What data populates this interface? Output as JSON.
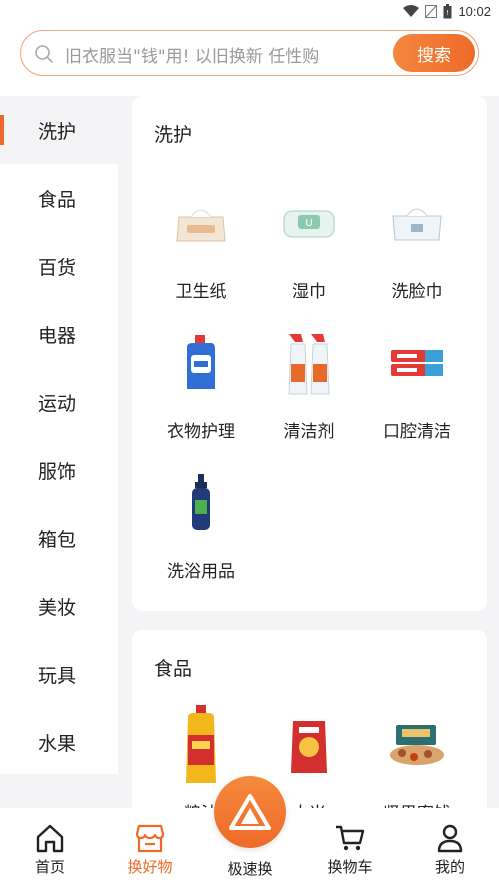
{
  "status_bar": {
    "time": "10:02"
  },
  "search": {
    "placeholder": "旧衣服当\"钱\"用! 以旧换新 任性购",
    "button": "搜索"
  },
  "sidebar": {
    "items": [
      "洗护",
      "食品",
      "百货",
      "电器",
      "运动",
      "服饰",
      "箱包",
      "美妆",
      "玩具",
      "水果"
    ],
    "active_index": 0
  },
  "sections": [
    {
      "title": "洗护",
      "items": [
        {
          "label": "卫生纸",
          "icon": "tissue-box-icon"
        },
        {
          "label": "湿巾",
          "icon": "wet-wipes-icon"
        },
        {
          "label": "洗脸巾",
          "icon": "face-towel-icon"
        },
        {
          "label": "衣物护理",
          "icon": "laundry-detergent-icon"
        },
        {
          "label": "清洁剂",
          "icon": "spray-bottle-icon"
        },
        {
          "label": "口腔清洁",
          "icon": "toothpaste-icon"
        },
        {
          "label": "洗浴用品",
          "icon": "shampoo-bottle-icon"
        }
      ]
    },
    {
      "title": "食品",
      "items": [
        {
          "label": "粮油",
          "icon": "cooking-oil-icon"
        },
        {
          "label": "大米",
          "icon": "rice-bag-icon"
        },
        {
          "label": "坚果蜜饯",
          "icon": "nut-gift-box-icon"
        }
      ]
    }
  ],
  "tabbar": {
    "tabs": [
      {
        "label": "首页",
        "icon": "home-icon"
      },
      {
        "label": "换好物",
        "icon": "shop-icon"
      },
      {
        "label": "极速换",
        "icon": "fast-exchange-icon"
      },
      {
        "label": "换物车",
        "icon": "cart-icon"
      },
      {
        "label": "我的",
        "icon": "profile-icon"
      }
    ],
    "active_index": 1
  },
  "colors": {
    "accent": "#ee6a28",
    "background": "#f4f4f6",
    "card": "#ffffff"
  }
}
